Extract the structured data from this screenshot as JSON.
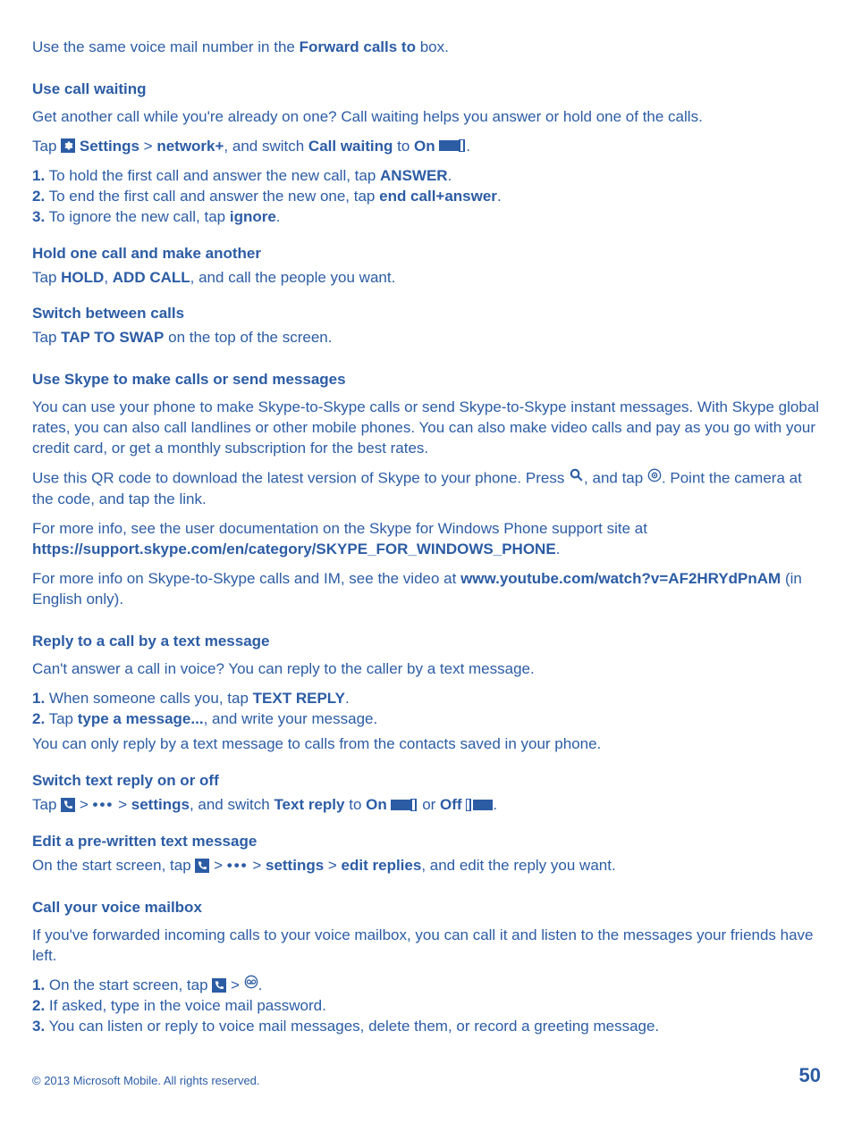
{
  "intro": {
    "pre": "Use the same voice mail number in the ",
    "bold": "Forward calls to",
    "post": " box."
  },
  "callWaiting": {
    "heading": "Use call waiting",
    "desc": "Get another call while you're already on one? Call waiting helps you answer or hold one of the calls.",
    "tap": {
      "pre": "Tap ",
      "settings": " Settings",
      "gt1": " > ",
      "network": "network+",
      "mid": ", and switch ",
      "cw": "Call waiting",
      "to": " to ",
      "on": "On",
      "post": "."
    },
    "steps": [
      {
        "n": "1.",
        "pre": " To hold the first call and answer the new call, tap ",
        "b": "ANSWER",
        "post": "."
      },
      {
        "n": "2.",
        "pre": " To end the first call and answer the new one, tap ",
        "b": "end call+answer",
        "post": "."
      },
      {
        "n": "3.",
        "pre": " To ignore the new call, tap ",
        "b": "ignore",
        "post": "."
      }
    ],
    "hold": {
      "heading": "Hold one call and make another",
      "pre": "Tap ",
      "b1": "HOLD",
      "c1": ", ",
      "b2": "ADD CALL",
      "post": ", and call the people you want."
    },
    "switch": {
      "heading": "Switch between calls",
      "pre": "Tap ",
      "b": "TAP TO SWAP",
      "post": " on the top of the screen."
    }
  },
  "skype": {
    "heading": "Use Skype to make calls or send messages",
    "p1": "You can use your phone to make Skype-to-Skype calls or send Skype-to-Skype instant messages. With Skype global rates, you can also call landlines or other mobile phones. You can also make video calls and pay as you go with your credit card, or get a monthly subscription for the best rates.",
    "p2pre": "Use this QR code to download the latest version of Skype to your phone. Press ",
    "p2mid": ", and tap ",
    "p2post": ". Point the camera at the code, and tap the link.",
    "p3pre": "For more info, see the user documentation on the Skype for Windows Phone support site at ",
    "p3link": "https://support.skype.com/en/category/SKYPE_FOR_WINDOWS_PHONE",
    "p3post": ".",
    "p4pre": "For more info on Skype-to-Skype calls and IM, see the video at ",
    "p4link": "www.youtube.com/watch?v=AF2HRYdPnAM",
    "p4post": " (in English only)."
  },
  "textReply": {
    "heading": "Reply to a call by a text message",
    "desc": "Can't answer a call in voice? You can reply to the caller by a text message.",
    "steps": [
      {
        "n": "1.",
        "pre": " When someone calls you, tap ",
        "b": "TEXT REPLY",
        "post": "."
      },
      {
        "n": "2.",
        "pre": " Tap ",
        "b": "type a message...",
        "post": ", and write your message."
      }
    ],
    "note": "You can only reply by a text message to calls from the contacts saved in your phone.",
    "switch": {
      "heading": "Switch text reply on or off",
      "t1": "Tap ",
      "gt1": " > ",
      "gt2": " > ",
      "settings": "settings",
      "mid": ", and switch ",
      "tr": "Text reply",
      "to": " to ",
      "on": "On",
      "or": " or ",
      "off": "Off",
      "post": "."
    },
    "edit": {
      "heading": "Edit a pre-written text message",
      "pre": "On the start screen, tap ",
      "gt1": " > ",
      "gt2": " > ",
      "settings": "settings",
      "gt3": " > ",
      "er": "edit replies",
      "post": ", and edit the reply you want."
    }
  },
  "voicemail": {
    "heading": "Call your voice mailbox",
    "desc": "If you've forwarded incoming calls to your voice mailbox, you can call it and listen to the messages your friends have left.",
    "steps": [
      {
        "n": "1.",
        "pre": " On the start screen, tap ",
        "gt": " > ",
        "post": "."
      },
      {
        "n": "2.",
        "text": " If asked, type in the voice mail password."
      },
      {
        "n": "3.",
        "text": " You can listen or reply to voice mail messages, delete them, or record a greeting message."
      }
    ]
  },
  "footer": {
    "copyright": "© 2013 Microsoft Mobile. All rights reserved.",
    "page": "50"
  }
}
